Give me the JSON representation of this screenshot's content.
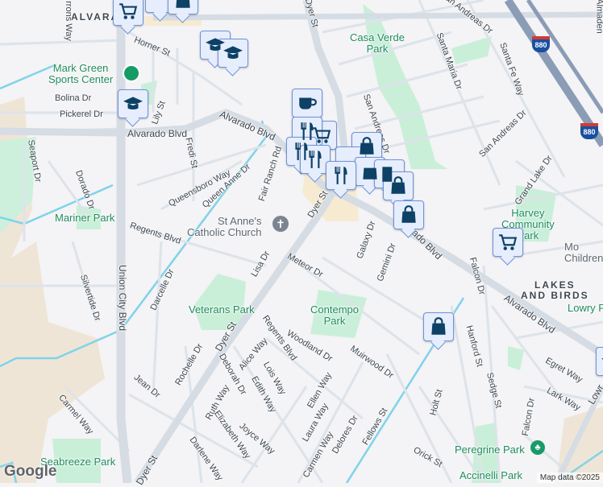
{
  "colors": {
    "background": "#f4f3f5",
    "road": "#d5dce4",
    "highway": "#8a9cb6",
    "park": "#c9efd9",
    "water": "#7fd3ea",
    "marker_fill": "#e6edfc",
    "marker_icon": "#0d4166",
    "park_text": "#1e8c5c"
  },
  "districts": {
    "alvarado": "ALVARADO",
    "lakes_and_birds_1": "LAKES",
    "lakes_and_birds_2": "AND BIRDS"
  },
  "parks": {
    "mark_green_1": "Mark Green",
    "mark_green_2": "Sports Center",
    "mariner": "Mariner Park",
    "casa_verde_1": "Casa Verde",
    "casa_verde_2": "Park",
    "harvey_1": "Harvey",
    "harvey_2": "Community",
    "harvey_3": "Park",
    "veterans": "Veterans Park",
    "contempo_1": "Contempo",
    "contempo_2": "Park",
    "seabreeze": "Seabreeze Park",
    "peregrine": "Peregrine Park",
    "accinelli": "Accinelli Park",
    "lowry": "Lowry P"
  },
  "pois": {
    "st_annes_1": "St Anne's",
    "st_annes_2": "Catholic Church",
    "children_1": "Mo",
    "children_2": "Children's"
  },
  "streets": {
    "barrons": "rrons Way",
    "horner": "Horner St",
    "bolina": "Bolina Dr",
    "pickerel": "Pickerel Dr",
    "lily": "Lily St",
    "alvarado1": "Alvarado Blvd",
    "alvarado2": "Alvarado Blvd",
    "alvarado3": "Alvarado Blvd",
    "alvarado4": "Alvarado Blvd",
    "seaport": "Seaport Dr",
    "fredi": "Fredi St",
    "queensboro": "Queensboro Way",
    "queen_anne": "Queen Anne Dr",
    "fair_ranch": "Fair Ranch Rd",
    "dorado": "Dorado Dr",
    "regents1": "Regents Blvd",
    "regents2": "Regents Blvd",
    "dyer1": "Dyer St",
    "dyer2": "Dyer St",
    "dyer3": "Dyer St",
    "dyer4": "Dyer St",
    "santa_maria": "Santa Maria Dr",
    "san_andreas1": "San Andreas Dr",
    "san_andreas2": "San Andreas Dr",
    "san_andreas3": "San Andreas Dr",
    "santa_fe": "Santa Fe Way",
    "grand_lake": "Grand Lake Dr",
    "almaden": "Almaden",
    "galaxy": "Galaxy Dr",
    "meteor": "Meteor Dr",
    "gemini": "Gemini Dr",
    "lisa": "Lisa Dr",
    "union_city": "Union City Blvd",
    "silvertide": "Silvertide Dr",
    "darcelle": "Darcelle Dr",
    "alice": "Alice Way",
    "woodland": "Woodland Dr",
    "rochelle": "Rochelle Dr",
    "deborah": "Deborah Dr",
    "lois": "Lois Way",
    "edith": "Edith Way",
    "ruth": "Ruth Way",
    "jean": "Jean Dr",
    "elizabeth": "Elizabeth Way",
    "joyce": "Joyce Way",
    "carmel": "Carmel Way",
    "darlene": "Darlene Way",
    "muirwood": "Muirwood Dr",
    "ellen": "Ellen Way",
    "laura": "Laura Way",
    "delores": "Delores Dr",
    "carmen": "Carmen Way",
    "fellows": "Fellows St",
    "holt": "Holt St",
    "orick": "Orick St",
    "falcon1": "Falcon Dr",
    "falcon2": "Falcon Dr",
    "hanford": "Hanford St",
    "sedge": "Sedge St",
    "egret": "Egret Way",
    "lark": "Lark Way",
    "lowry": "Lowr"
  },
  "highway": {
    "shield": "880"
  },
  "footer": {
    "logo": "Google",
    "attribution": "Map data ©2025"
  }
}
